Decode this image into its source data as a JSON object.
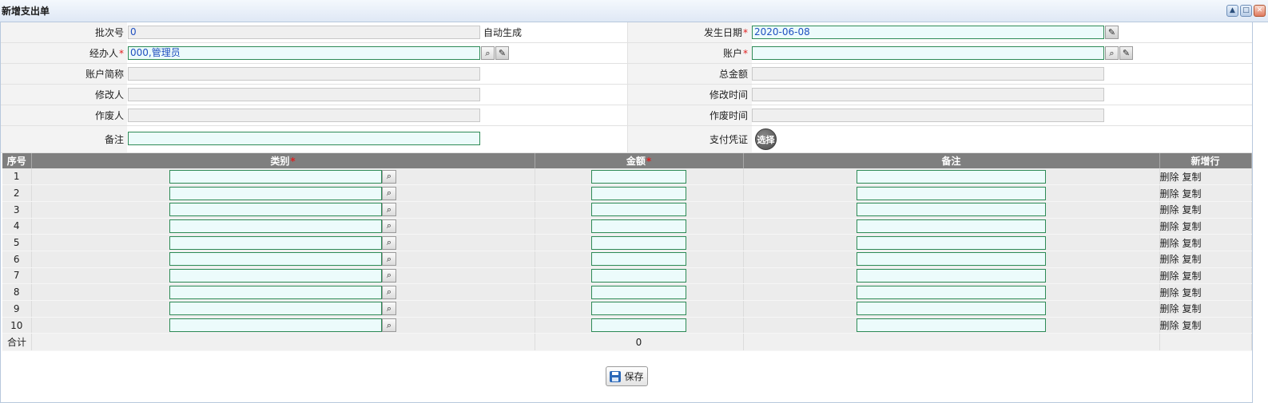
{
  "window": {
    "title": "新增支出单"
  },
  "form": {
    "batch_no": {
      "label": "批次号",
      "value": "0",
      "note": "自动生成"
    },
    "date": {
      "label": "发生日期",
      "value": "2020-06-08",
      "required": "*"
    },
    "handler": {
      "label": "经办人",
      "value": "000,管理员",
      "required": "*"
    },
    "account": {
      "label": "账户",
      "value": "",
      "required": "*"
    },
    "account_short": {
      "label": "账户简称",
      "value": ""
    },
    "total_amount": {
      "label": "总金额",
      "value": ""
    },
    "modifier": {
      "label": "修改人",
      "value": ""
    },
    "modify_time": {
      "label": "修改时间",
      "value": ""
    },
    "voider": {
      "label": "作废人",
      "value": ""
    },
    "void_time": {
      "label": "作废时间",
      "value": ""
    },
    "remark": {
      "label": "备注",
      "value": ""
    },
    "voucher": {
      "label": "支付凭证",
      "select_label": "选择"
    }
  },
  "grid": {
    "headers": {
      "index": "序号",
      "category": "类别",
      "amount": "金额",
      "remark": "备注",
      "add_row": "新增行",
      "required": "*"
    },
    "rows": [
      "1",
      "2",
      "3",
      "4",
      "5",
      "6",
      "7",
      "8",
      "9",
      "10"
    ],
    "row_actions": {
      "delete": "删除",
      "copy": "复制"
    },
    "summary": {
      "label": "合计",
      "amount": "0"
    }
  },
  "footer": {
    "save_label": "保存"
  },
  "icons": {
    "search": "search-icon",
    "edit": "pencil-icon",
    "save": "floppy-disk-icon",
    "minimize": "minimize-icon",
    "maximize": "maximize-icon",
    "close": "close-icon"
  },
  "colors": {
    "editable_bg": "#ecfbfb",
    "editable_border": "#2e8b57",
    "header_bg": "#7f7f7f",
    "required": "#e02020",
    "value_text": "#2050c0"
  }
}
